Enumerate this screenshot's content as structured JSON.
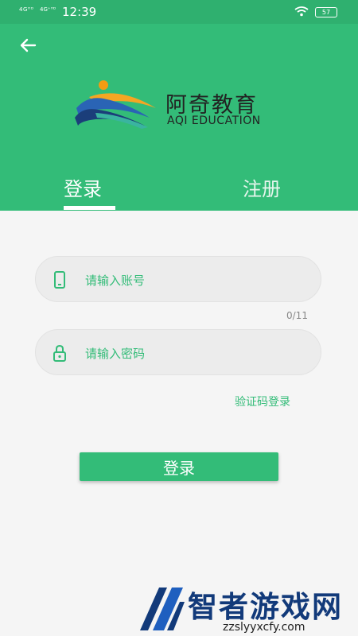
{
  "status_bar": {
    "signal_1": "4Gᴴᴰ",
    "signal_2": "4G⁺ᴴᴰ",
    "time": "12:39",
    "battery": "57"
  },
  "brand": {
    "name_cn": "阿奇教育",
    "name_en": "AQI EDUCATION"
  },
  "tabs": {
    "login": "登录",
    "register": "注册",
    "active": "login"
  },
  "form": {
    "account_placeholder": "请输入账号",
    "account_counter": "0/11",
    "password_placeholder": "请输入密码",
    "sms_login_link": "验证码登录",
    "submit_label": "登录"
  },
  "watermark": {
    "text": "智者游戏网",
    "url": "zzslyyxcfy.com"
  },
  "colors": {
    "accent": "#33bc78",
    "background": "#f5f5f5"
  },
  "icons": [
    "back-arrow-icon",
    "phone-icon",
    "lock-icon",
    "wifi-icon",
    "battery-icon"
  ]
}
